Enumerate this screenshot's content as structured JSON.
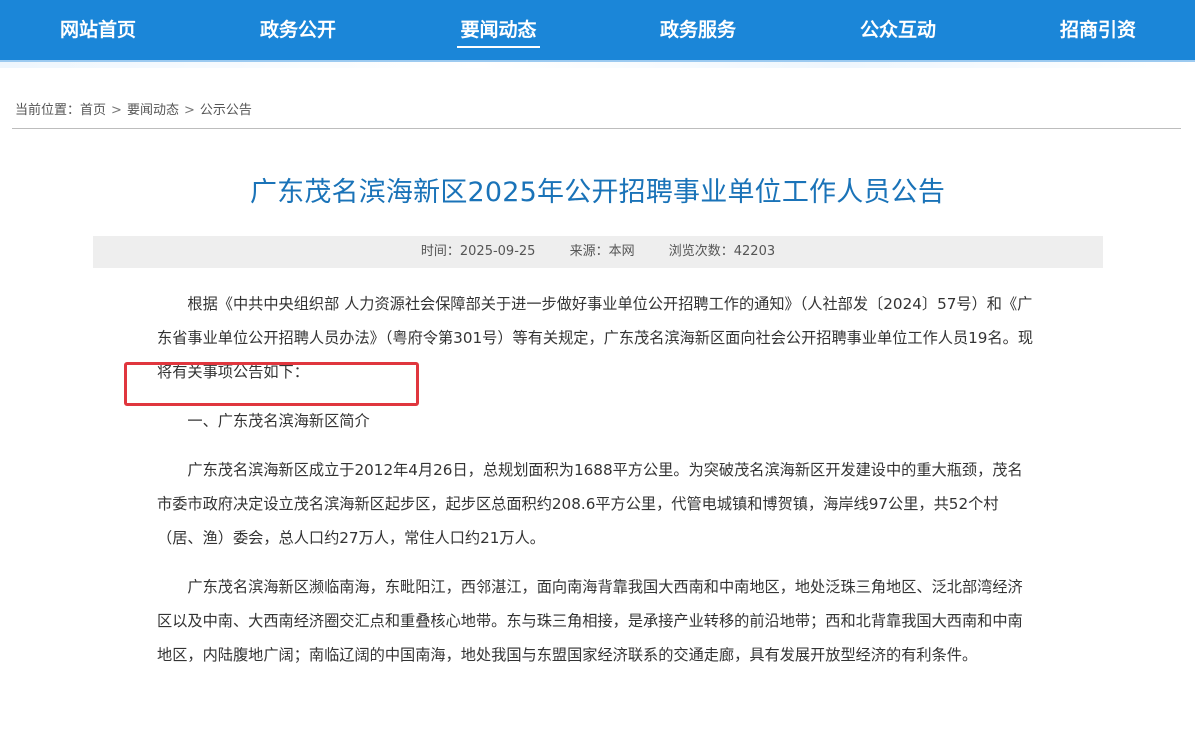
{
  "nav": {
    "items": [
      {
        "label": "网站首页"
      },
      {
        "label": "政务公开"
      },
      {
        "label": "要闻动态"
      },
      {
        "label": "政务服务"
      },
      {
        "label": "公众互动"
      },
      {
        "label": "招商引资"
      }
    ],
    "active_index": 2
  },
  "breadcrumb": {
    "prefix": "当前位置：",
    "items": [
      "首页",
      "要闻动态",
      "公示公告"
    ],
    "separator": ">"
  },
  "article": {
    "title": "广东茂名滨海新区2025年公开招聘事业单位工作人员公告",
    "meta": {
      "time": "时间：2025-09-25",
      "source": "来源：本网",
      "views": "浏览次数：42203"
    },
    "paragraphs": [
      "根据《中共中央组织部 人力资源社会保障部关于进一步做好事业单位公开招聘工作的通知》（人社部发〔2024〕57号）和《广东省事业单位公开招聘人员办法》（粤府令第301号）等有关规定，广东茂名滨海新区面向社会公开招聘事业单位工作人员19名。现将有关事项公告如下：",
      "一、广东茂名滨海新区简介",
      "广东茂名滨海新区成立于2012年4月26日，总规划面积为1688平方公里。为突破茂名滨海新区开发建设中的重大瓶颈，茂名市委市政府决定设立茂名滨海新区起步区，起步区总面积约208.6平方公里，代管电城镇和博贺镇，海岸线97公里，共52个村（居、渔）委会，总人口约27万人，常住人口约21万人。",
      "广东茂名滨海新区濒临南海，东毗阳江，西邻湛江，面向南海背靠我国大西南和中南地区，地处泛珠三角地区、泛北部湾经济区以及中南、大西南经济圈交汇点和重叠核心地带。东与珠三角相接，是承接产业转移的前沿地带；西和北背靠我国大西南和中南地区，内陆腹地广阔；南临辽阔的中国南海，地处我国与东盟国家经济联系的交通走廊，具有发展开放型经济的有利条件。"
    ]
  },
  "colors": {
    "nav_bg": "#1b86d8",
    "title": "#1a73b8",
    "highlight": "#e0363e",
    "meta_bg": "#eeeeee"
  }
}
